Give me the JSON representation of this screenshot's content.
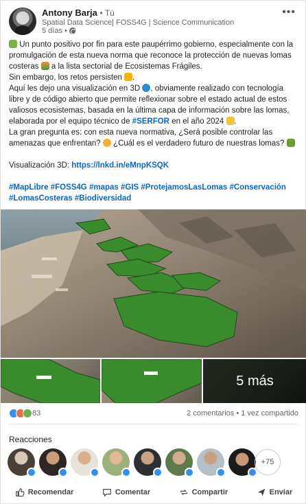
{
  "author": {
    "name": "Antony Barja",
    "degree": "• Tú",
    "tagline": "Spatial Data Science| FOSS4G | Science Communication",
    "time": "5 días •"
  },
  "post": {
    "p1": "Un punto positivo por fin para este paupérrimo gobierno, especialmente con la promulgación de esta nueva norma que reconoce la protección de nuevas lomas costeras",
    "p1b": "a la lista sectorial de Ecosistemas Frágiles.",
    "p2": "Sin embargo, los retos persisten",
    "p3a": "Aquí les dejo una visualización en 3D",
    "p3b": ", obviamente realizado con tecnología libre y de código abierto que permite reflexionar sobre el estado actual de estos valiosos ecosistemas, basada en la última capa de información sobre las lomas, elaborada por el equipo técnico de",
    "p3tag": "#SERFOR",
    "p3c": "en el año 2024",
    "p4a": "La gran pregunta es: con esta nueva normativa, ¿Será posible controlar las amenazas que enfrentan?",
    "p4b": "¿Cuál es el verdadero futuro de nuestras lomas?",
    "viz_label": "Visualización 3D:",
    "viz_link": "https://lnkd.in/eMnpKSQK",
    "hashtags": "#MapLibre #FOSS4G #mapas #GIS #ProtejamosLasLomas #Conservación #LomasCosteras #Biodiversidad"
  },
  "media": {
    "more_label": "5 más"
  },
  "stats": {
    "reactions_count": "83",
    "right": "2 comentarios • 1 vez compartido"
  },
  "reactions": {
    "title": "Reacciones",
    "more": "+75"
  },
  "actions": {
    "like": "Recomendar",
    "comment": "Comentar",
    "share": "Compartir",
    "send": "Enviar"
  },
  "colors": {
    "accent": "#0a66c2",
    "lomas_green": "#3a8a2e"
  }
}
